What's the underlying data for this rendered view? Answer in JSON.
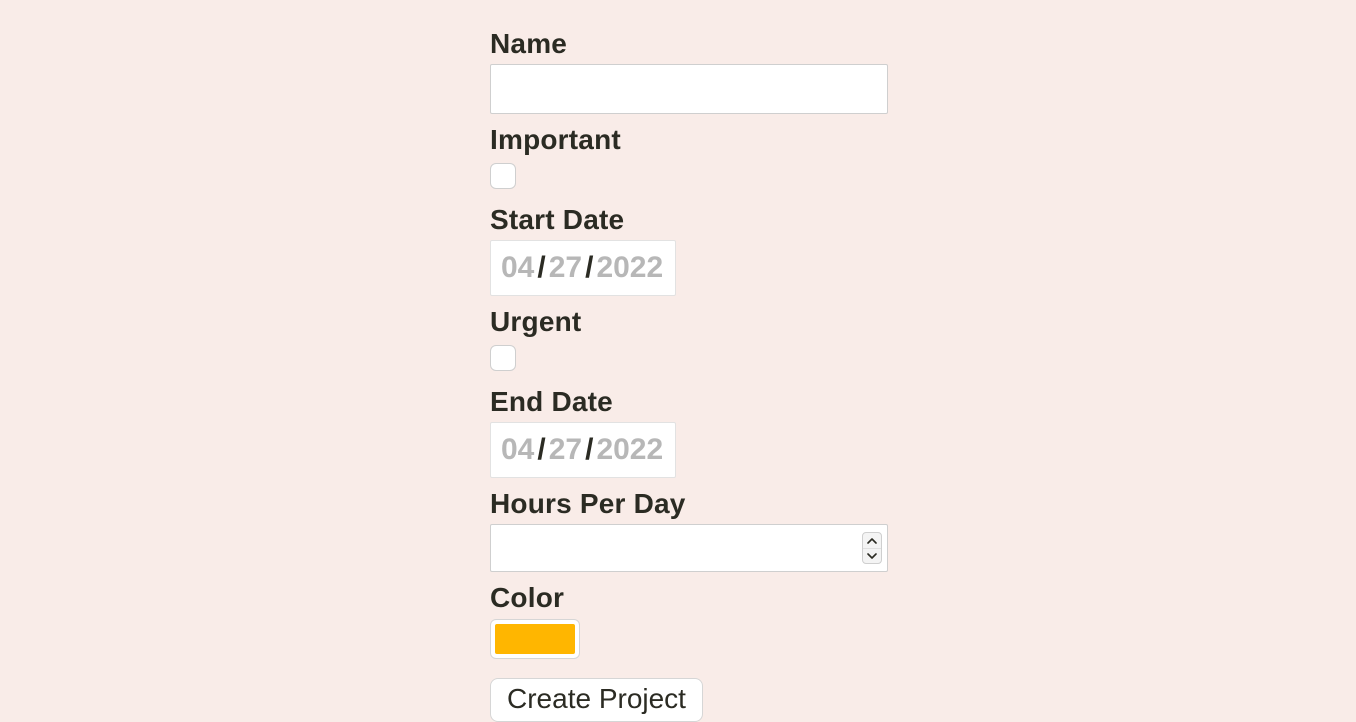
{
  "form": {
    "name": {
      "label": "Name",
      "value": ""
    },
    "important": {
      "label": "Important",
      "checked": false
    },
    "start_date": {
      "label": "Start Date",
      "mm": "04",
      "dd": "27",
      "yyyy": "2022"
    },
    "urgent": {
      "label": "Urgent",
      "checked": false
    },
    "end_date": {
      "label": "End Date",
      "mm": "04",
      "dd": "27",
      "yyyy": "2022"
    },
    "hours_per_day": {
      "label": "Hours Per Day",
      "value": ""
    },
    "color": {
      "label": "Color",
      "value": "#ffb600"
    },
    "submit": {
      "label": "Create Project"
    }
  }
}
